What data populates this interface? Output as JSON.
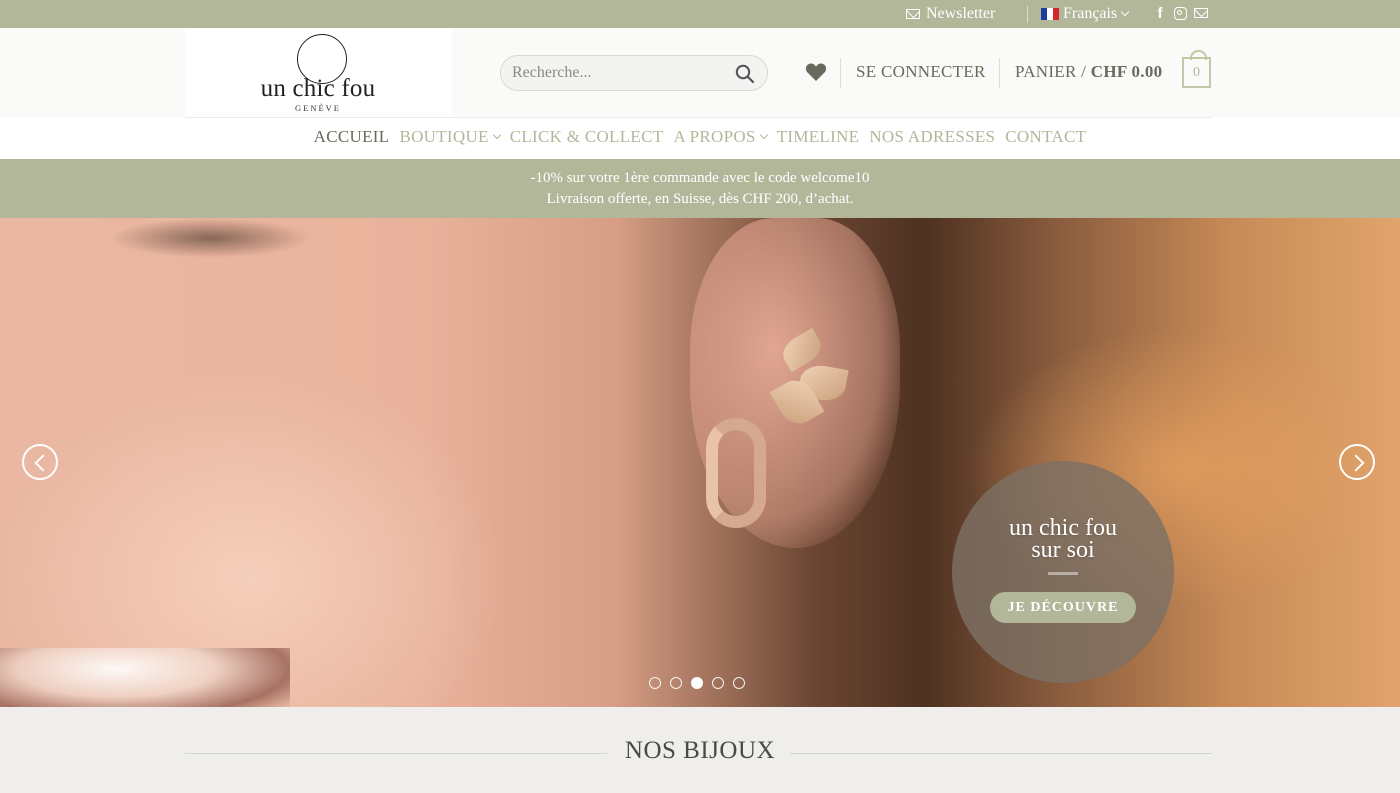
{
  "topbar": {
    "newsletter": "Newsletter",
    "language": "Français",
    "social_icons": [
      "facebook-icon",
      "instagram-icon",
      "email-icon"
    ]
  },
  "header": {
    "logo_text": "un chic fou",
    "logo_sub": "GENÈVE",
    "search_placeholder": "Recherche...",
    "login": "SE CONNECTER",
    "cart_label": "PANIER /",
    "cart_total": "CHF 0.00",
    "cart_count": "0"
  },
  "nav": {
    "items": [
      {
        "label": "ACCUEIL",
        "active": true
      },
      {
        "label": "BOUTIQUE",
        "dropdown": true
      },
      {
        "label": "CLICK & COLLECT"
      },
      {
        "label": "A PROPOS",
        "dropdown": true
      },
      {
        "label": "TIMELINE"
      },
      {
        "label": "NOS ADRESSES"
      },
      {
        "label": "CONTACT"
      }
    ]
  },
  "promo": {
    "line1": "-10% sur votre 1ère commande avec le code welcome10",
    "line2": "Livraison offerte, en Suisse, dès CHF 200, d’achat."
  },
  "hero": {
    "title_line1": "un chic fou",
    "title_line2": "sur soi",
    "button": "JE DÉCOUVRE",
    "slides": 5,
    "active_slide": 3
  },
  "section": {
    "title": "NOS BIJOUX"
  },
  "colors": {
    "accent": "#b3b79a",
    "text": "#6a6a5c",
    "background": "#efeeec"
  }
}
